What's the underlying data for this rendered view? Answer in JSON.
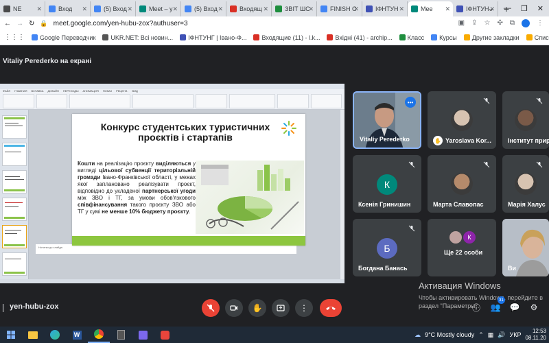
{
  "browser": {
    "tabs": [
      {
        "label": "NE",
        "color": "#4a4a4a"
      },
      {
        "label": "Вход",
        "color": "#4285f4"
      },
      {
        "label": "(5) Вход",
        "color": "#4285f4"
      },
      {
        "label": "Meet – y",
        "color": "#00897b"
      },
      {
        "label": "(5) Вход",
        "color": "#4285f4"
      },
      {
        "label": "Входящ",
        "color": "#d93025"
      },
      {
        "label": "ЗВІТ ШС",
        "color": "#1e8e3e"
      },
      {
        "label": "FINISH C",
        "color": "#4285f4"
      },
      {
        "label": "ІФНТУН",
        "color": "#3f51b5"
      },
      {
        "label": "Mee",
        "color": "#00897b",
        "active": true
      },
      {
        "label": "ІФНТУН",
        "color": "#3f51b5"
      }
    ],
    "new_tab": "+",
    "window_controls": [
      "⌄",
      "—",
      "❐",
      "✕"
    ],
    "url": "meet.google.com/yen-hubu-zox?authuser=3",
    "bookmarks": [
      {
        "label": "Google Переводчик",
        "color": "#4285f4"
      },
      {
        "label": "UKR.NET: Всі новин...",
        "color": "#555555"
      },
      {
        "label": "ІФНТУНГ | Івано-Ф...",
        "color": "#3f51b5"
      },
      {
        "label": "Входящие (11) - l.k...",
        "color": "#d93025"
      },
      {
        "label": "Вхідні (41) - archip...",
        "color": "#d93025"
      },
      {
        "label": "Класс",
        "color": "#1e8e3e"
      },
      {
        "label": "Курсы",
        "color": "#4285f4"
      }
    ],
    "bookmarks_right": [
      "Другие закладки",
      "Список д"
    ]
  },
  "meet": {
    "presenting_label": "Vitaliy Perederko на екрані",
    "meeting_code": "yen-hubu-zox",
    "participants": [
      {
        "name": "Vitaliy Perederko",
        "type": "video"
      },
      {
        "name": "Yaroslava Kor...",
        "type": "photo",
        "hand": true
      },
      {
        "name": "Інститут прир",
        "type": "photo"
      },
      {
        "name": "Ксенія Гринишин",
        "type": "letter",
        "letter": "К",
        "color": "#00897b"
      },
      {
        "name": "Марта Славопас",
        "type": "photo"
      },
      {
        "name": "Марія Халус",
        "type": "photo"
      },
      {
        "name": "Богдана Банась",
        "type": "letter",
        "letter": "Б",
        "color": "#5c6bc0"
      },
      {
        "name": "Ще 22 особи",
        "type": "more",
        "letter": "К"
      },
      {
        "name": "Ви",
        "type": "video"
      }
    ],
    "hand_count": "31"
  },
  "slide": {
    "title": "Конкурс студентських туристичних проєктів і стартапів",
    "body_parts": [
      {
        "t": "Кошти",
        "b": true
      },
      {
        "t": " на реалізацію проєкту "
      },
      {
        "t": "виділяються",
        "b": true
      },
      {
        "t": " у вигляді "
      },
      {
        "t": "цільової субвенції територіальній громади",
        "b": true
      },
      {
        "t": " Івано-Франківської області, у межах якої запланованo реалізувати проєкт, відповідно до укладеної "
      },
      {
        "t": "партнерської угоди",
        "b": true
      },
      {
        "t": " між ЗВО і ТГ, за умови обов'язкового "
      },
      {
        "t": "співфінансування",
        "b": true
      },
      {
        "t": " такого проєкту ЗВО або ТГ у сумі "
      },
      {
        "t": "не менше 10% бюджету проєкту",
        "b": true
      },
      {
        "t": "."
      }
    ],
    "notes_placeholder": "Нотатки до слайда"
  },
  "windows": {
    "activation_title": "Активация Windows",
    "activation_text": "Чтобы активировать Windows, перейдите в раздел \"Параметры\"."
  },
  "taskbar": {
    "weather": "9°C  Mostly cloudy",
    "lang": "УКР",
    "time": "12:53",
    "date": "08.11.20"
  }
}
